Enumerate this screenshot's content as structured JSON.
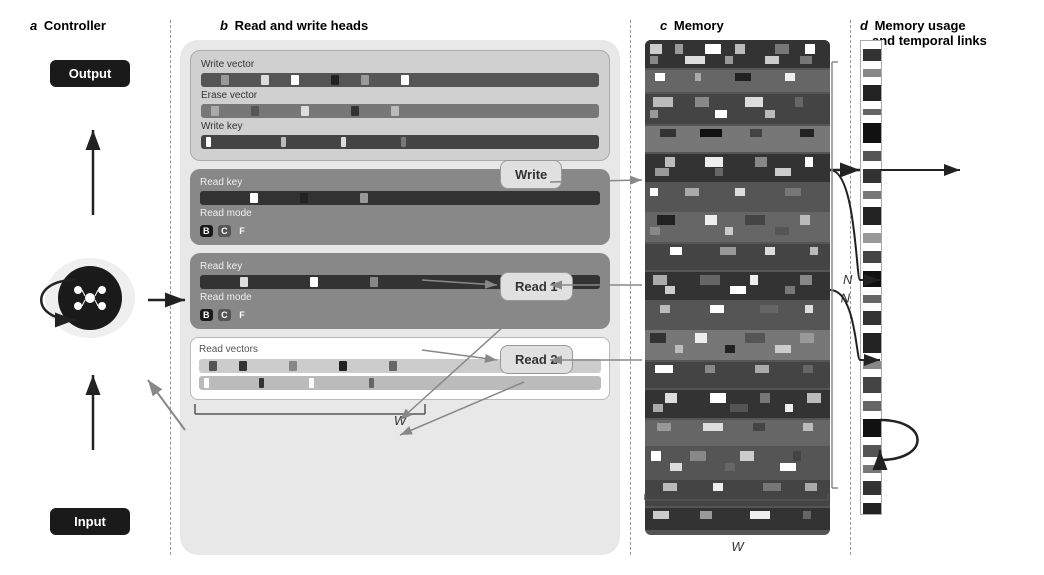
{
  "sections": {
    "a": {
      "letter": "a",
      "title": "Controller",
      "output_label": "Output",
      "input_label": "Input"
    },
    "b": {
      "letter": "b",
      "title": "Read and write heads",
      "write_head": {
        "rows": [
          {
            "label": "Write vector"
          },
          {
            "label": "Erase vector"
          },
          {
            "label": "Write key"
          }
        ]
      },
      "read_heads": [
        {
          "rows": [
            {
              "label": "Read key"
            },
            {
              "label": "Read mode"
            }
          ]
        },
        {
          "rows": [
            {
              "label": "Read key"
            },
            {
              "label": "Read mode"
            }
          ]
        }
      ],
      "read_vectors": {
        "label": "Read vectors"
      },
      "operations": {
        "write": "Write",
        "read1": "Read 1",
        "read2": "Read 2"
      },
      "w_label": "W"
    },
    "c": {
      "letter": "c",
      "title": "Memory",
      "w_label": "W",
      "n_label": "N"
    },
    "d": {
      "letter": "d",
      "title": "Memory usage",
      "subtitle": "and temporal links"
    }
  },
  "colors": {
    "black": "#1a1a1a",
    "darkGray": "#555",
    "midGray": "#888",
    "lightGray": "#e0e0e0",
    "white": "#ffffff",
    "accent": "#333"
  }
}
